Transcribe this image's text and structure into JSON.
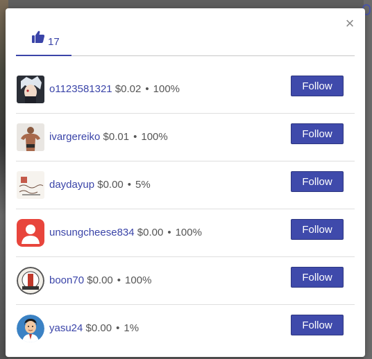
{
  "likes_tab": {
    "icon": "thumbs-up-icon",
    "count": "17"
  },
  "close_icon": "close-icon",
  "follow_label": "Follow",
  "voters": [
    {
      "username": "o1123581321",
      "amount": "$0.02",
      "percent": "100%",
      "avatar": "anime-character-avatar"
    },
    {
      "username": "ivargereiko",
      "amount": "$0.01",
      "percent": "100%",
      "avatar": "bodybuilder-photo-avatar"
    },
    {
      "username": "daydayup",
      "amount": "$0.00",
      "percent": "5%",
      "avatar": "handwritten-note-avatar"
    },
    {
      "username": "unsungcheese834",
      "amount": "$0.00",
      "percent": "100%",
      "avatar": "default-user-avatar"
    },
    {
      "username": "boon70",
      "amount": "$0.00",
      "percent": "100%",
      "avatar": "badge-logo-avatar"
    },
    {
      "username": "yasu24",
      "amount": "$0.00",
      "percent": "1%",
      "avatar": "cartoon-man-avatar"
    }
  ],
  "colors": {
    "accent": "#3a44a8",
    "button": "#3f4aab",
    "default_avatar": "#e8453c"
  }
}
